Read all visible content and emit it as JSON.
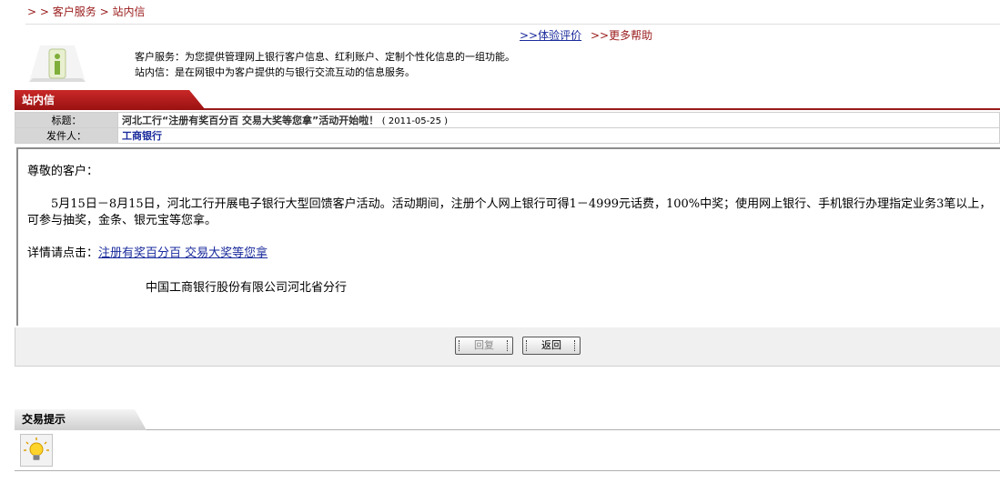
{
  "breadcrumb": {
    "prefix": "> > ",
    "customer_service": "客户服务",
    "sep": " > ",
    "current": "站内信"
  },
  "toplinks": {
    "eval_prefix": ">>",
    "eval": "体验评价",
    "help_prefix": ">>",
    "help": "更多帮助"
  },
  "desc": {
    "line1": "客户服务：为您提供管理网上银行客户信息、红利账户、定制个性化信息的一组功能。",
    "line2": "站内信：是在网银中为客户提供的与银行交流互动的信息服务。"
  },
  "section": {
    "title": "站内信"
  },
  "message": {
    "title_label": "标题：",
    "title": "河北工行“注册有奖百分百 交易大奖等您拿”活动开始啦！",
    "date": "( 2011-05-25 )",
    "sender_label": "发件人：",
    "sender": "工商银行",
    "greeting": "尊敬的客户：",
    "paragraph": "5月15日－8月15日，河北工行开展电子银行大型回馈客户活动。活动期间，注册个人网上银行可得1－4999元话费，100%中奖；使用网上银行、手机银行办理指定业务3笔以上，可参与抽奖，金条、银元宝等您拿。",
    "detail_label": "详情请点击：",
    "detail_link": "注册有奖百分百 交易大奖等您拿",
    "signature": "中国工商银行股份有限公司河北省分行"
  },
  "buttons": {
    "reply": "回复",
    "back": "返回"
  },
  "tips": {
    "title": "交易提示"
  },
  "icons": {
    "info": "info-icon",
    "bulb": "lightbulb-icon"
  },
  "colors": {
    "brand_red": "#9a1b1b",
    "link_blue": "#1a2b9c"
  }
}
